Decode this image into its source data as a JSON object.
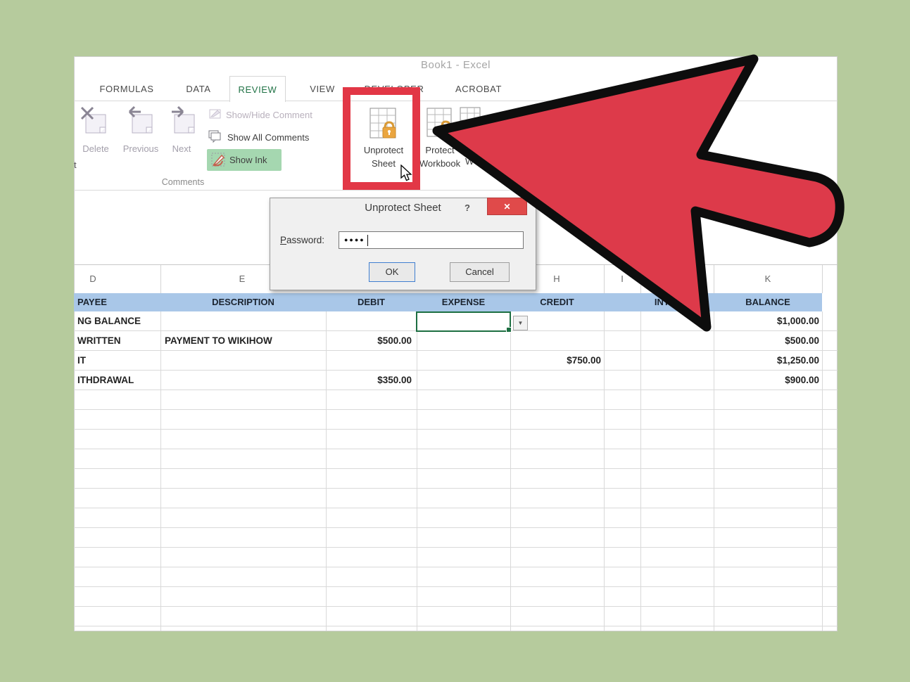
{
  "titlebar": {
    "title": "Book1 - Excel"
  },
  "tabs": [
    {
      "label": "FORMULAS"
    },
    {
      "label": "DATA"
    },
    {
      "label": "REVIEW",
      "active": true
    },
    {
      "label": "VIEW"
    },
    {
      "label": "DEVELOPER"
    },
    {
      "label": "ACROBAT"
    }
  ],
  "ribbon": {
    "delete": "Delete",
    "previous": "Previous",
    "next": "Next",
    "show_hide_comment": "Show/Hide Comment",
    "show_all_comments": "Show All Comments",
    "show_ink": "Show Ink",
    "unprotect_line1": "Unprotect",
    "unprotect_line2": "Sheet",
    "protect_line1": "Protect",
    "protect_line2": "Workbook",
    "next_button_fragment": "W",
    "group_comments": "Comments",
    "edge_fragment": "t"
  },
  "dialog": {
    "title": "Unprotect Sheet",
    "help_glyph": "?",
    "close_glyph": "✕",
    "password_initial": "P",
    "password_rest": "assword:",
    "password_masked": "●●●●",
    "ok": "OK",
    "cancel": "Cancel"
  },
  "sheet": {
    "letters": [
      "D",
      "E",
      "H",
      "I",
      "K"
    ],
    "headers": [
      "PAYEE",
      "DESCRIPTION",
      "DEBIT",
      "EXPENSE",
      "CREDIT",
      "INTEREST",
      "BALANCE"
    ],
    "rows": [
      {
        "payee": "NG BALANCE",
        "description": "",
        "debit": "",
        "credit": "",
        "balance": "$1,000.00"
      },
      {
        "payee": "WRITTEN",
        "description": "PAYMENT TO WIKIHOW",
        "debit": "$500.00",
        "credit": "",
        "balance": "$500.00"
      },
      {
        "payee": "IT",
        "description": "",
        "debit": "",
        "credit": "$750.00",
        "balance": "$1,250.00"
      },
      {
        "payee": "ITHDRAWAL",
        "description": "",
        "debit": "$350.00",
        "credit": "",
        "balance": "$900.00"
      }
    ],
    "dropdown_glyph": "▼"
  },
  "colors": {
    "background_green": "#b6cb9d",
    "excel_green": "#217346",
    "header_blue": "#a9c7e8",
    "arrow_red": "#dd3a4a",
    "highlight_red": "#e23746",
    "ink_highlight_green": "#a5d7b0",
    "close_button_red": "#e04a4a"
  }
}
